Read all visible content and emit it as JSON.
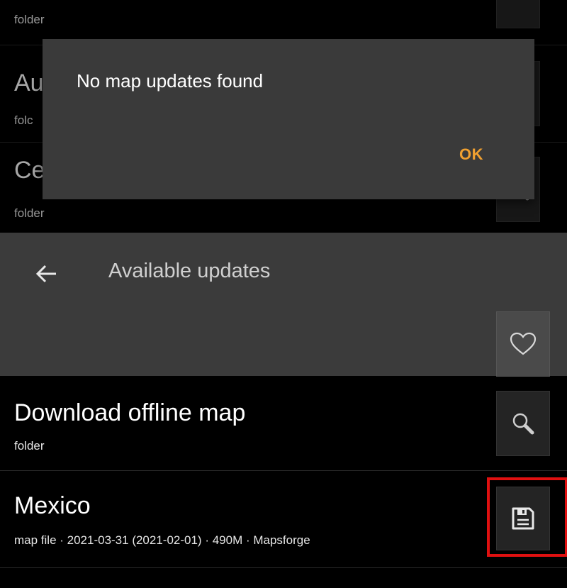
{
  "background_list": [
    {
      "title": "",
      "subtitle": "folder"
    },
    {
      "title": "Au",
      "subtitle": "folc"
    },
    {
      "title": "Ce",
      "subtitle": "folder"
    }
  ],
  "dialog": {
    "message": "No map updates found",
    "ok_label": "OK"
  },
  "toolbar": {
    "title": "Available updates",
    "back_icon": "arrow-left-icon",
    "favorite_icon": "heart-outline-icon"
  },
  "list": [
    {
      "title": "Download offline map",
      "subtitle": "folder",
      "icon": "magnifier-icon"
    },
    {
      "title": "Mexico",
      "subtitle": "map file · 2021-03-31 (2021-02-01) · 490M · Mapsforge",
      "icon": "floppy-save-icon"
    }
  ],
  "colors": {
    "background": "#000000",
    "dialog": "#3a3a3a",
    "toolbar": "#3b3b3b",
    "accent": "#f0a030",
    "highlight": "#e01010"
  }
}
